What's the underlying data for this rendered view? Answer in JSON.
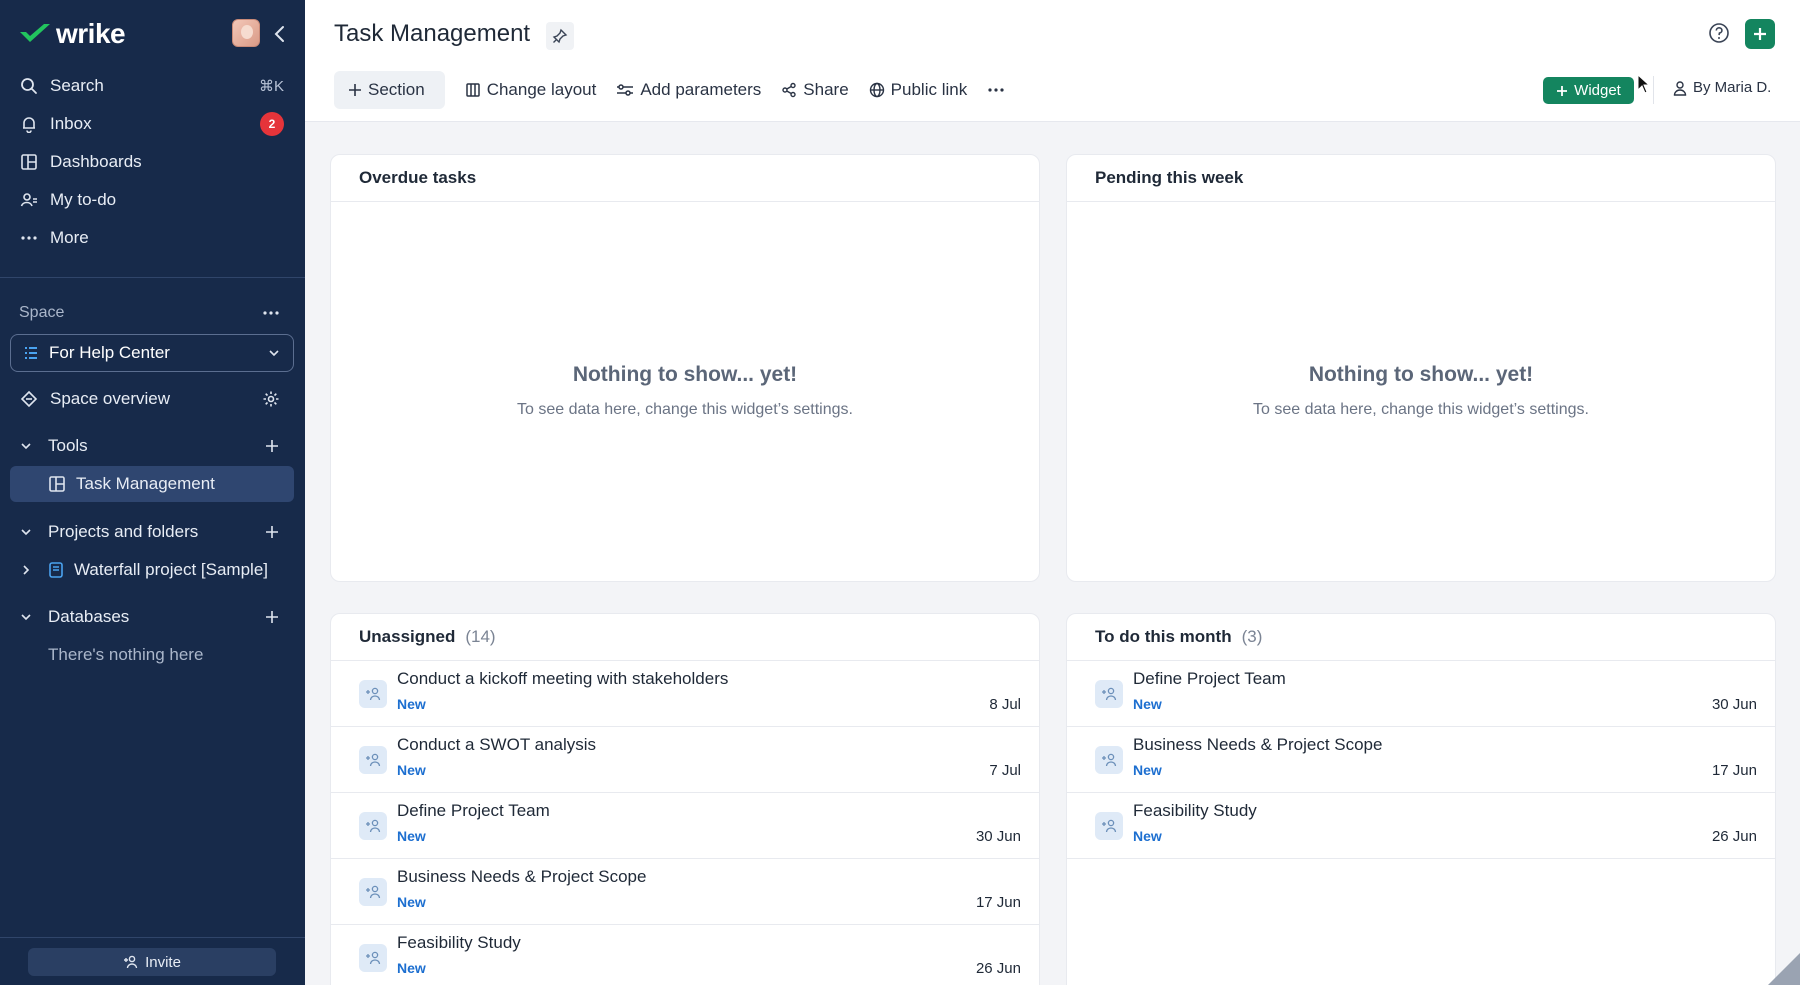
{
  "app": {
    "logo_text": "wrike"
  },
  "sidebar": {
    "search": {
      "label": "Search",
      "shortcut": "⌘K"
    },
    "inbox": {
      "label": "Inbox",
      "badge": "2"
    },
    "dashboards": {
      "label": "Dashboards"
    },
    "todo": {
      "label": "My to-do"
    },
    "more": {
      "label": "More"
    },
    "space_label": "Space",
    "space_selected": "For Help Center",
    "space_overview": "Space overview",
    "tools": {
      "label": "Tools",
      "items": [
        {
          "label": "Task Management"
        }
      ]
    },
    "projects": {
      "label": "Projects and folders",
      "items": [
        {
          "label": "Waterfall project [Sample]"
        }
      ]
    },
    "databases": {
      "label": "Databases",
      "empty": "There's nothing here"
    },
    "invite_label": "Invite"
  },
  "header": {
    "title": "Task Management",
    "toolbar": {
      "section": "Section",
      "change_layout": "Change layout",
      "add_parameters": "Add parameters",
      "share": "Share",
      "public_link": "Public link"
    },
    "widget_label": "Widget",
    "by_user": "By Maria D."
  },
  "widgets": {
    "overdue": {
      "title": "Overdue tasks",
      "empty_title": "Nothing to show... yet!",
      "empty_sub": "To see data here, change this widget’s settings."
    },
    "pending": {
      "title": "Pending this week",
      "empty_title": "Nothing to show... yet!",
      "empty_sub": "To see data here, change this widget’s settings."
    },
    "unassigned": {
      "title": "Unassigned",
      "count": "(14)",
      "tasks": [
        {
          "name": "Conduct a kickoff meeting with stakeholders",
          "status": "New",
          "date": "8 Jul"
        },
        {
          "name": "Conduct a SWOT analysis",
          "status": "New",
          "date": "7 Jul"
        },
        {
          "name": "Define Project Team",
          "status": "New",
          "date": "30 Jun"
        },
        {
          "name": "Business Needs & Project Scope",
          "status": "New",
          "date": "17 Jun"
        },
        {
          "name": "Feasibility Study",
          "status": "New",
          "date": "26 Jun"
        }
      ]
    },
    "todo_month": {
      "title": "To do this month",
      "count": "(3)",
      "tasks": [
        {
          "name": "Define Project Team",
          "status": "New",
          "date": "30 Jun"
        },
        {
          "name": "Business Needs & Project Scope",
          "status": "New",
          "date": "17 Jun"
        },
        {
          "name": "Feasibility Study",
          "status": "New",
          "date": "26 Jun"
        }
      ]
    }
  },
  "colors": {
    "sidebar_bg": "#172a4a",
    "accent_green": "#14855f",
    "status_blue": "#1d6fd0",
    "badge_red": "#e5343a"
  }
}
